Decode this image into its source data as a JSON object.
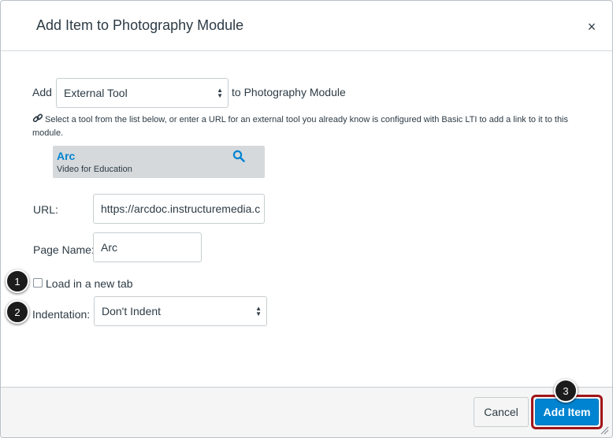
{
  "dialog": {
    "title": "Add Item to Photography Module",
    "close_label": "×"
  },
  "add_row": {
    "prefix": "Add",
    "type_select_value": "External Tool",
    "suffix": "to Photography Module"
  },
  "help_text": "Select a tool from the list below, or enter a URL for an external tool you already know is configured with Basic LTI to add a link to it to this module.",
  "tools": [
    {
      "name": "Arc",
      "description": "Video for Education"
    }
  ],
  "url_field": {
    "label": "URL:",
    "value": "https://arcdoc.instructuremedia.c"
  },
  "page_name_field": {
    "label": "Page Name:",
    "value": "Arc"
  },
  "new_tab": {
    "label": "Load in a new tab",
    "checked": false
  },
  "indentation": {
    "label": "Indentation:",
    "value": "Don't Indent"
  },
  "footer": {
    "cancel_label": "Cancel",
    "add_label": "Add Item"
  },
  "callouts": [
    "1",
    "2",
    "3"
  ],
  "colors": {
    "accent": "#0084d1",
    "text": "#2d3b45",
    "highlight_outline": "#a0151a",
    "tool_list_bg": "#d5d9dc"
  },
  "icons": {
    "close": "close-icon",
    "link": "link-icon",
    "search": "search-icon",
    "select_arrows": "select-arrows-icon",
    "resize": "resize-grip-icon"
  }
}
